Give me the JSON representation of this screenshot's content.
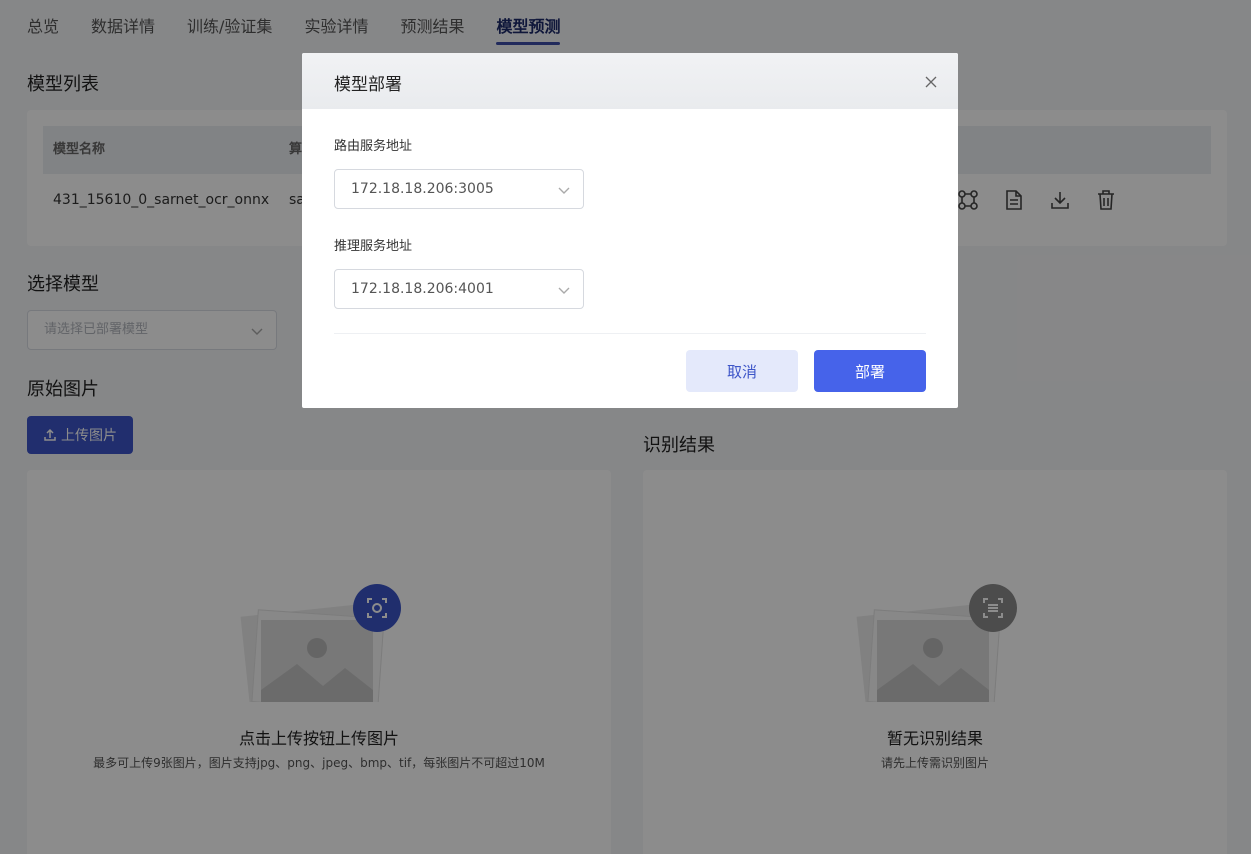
{
  "tabs": [
    {
      "label": "总览"
    },
    {
      "label": "数据详情"
    },
    {
      "label": "训练/验证集"
    },
    {
      "label": "实验详情"
    },
    {
      "label": "预测结果"
    },
    {
      "label": "模型预测",
      "active": true
    }
  ],
  "model_list": {
    "title": "模型列表",
    "columns": [
      "模型名称",
      "算"
    ],
    "rows": [
      {
        "name": "431_15610_0_sarnet_ocr_onnx",
        "algo": "sa"
      }
    ],
    "row_actions": [
      "deploy-graph-icon",
      "document-icon",
      "download-icon",
      "delete-icon"
    ]
  },
  "select_model": {
    "title": "选择模型",
    "placeholder": "请选择已部署模型"
  },
  "original_image": {
    "title": "原始图片",
    "upload_label": "上传图片",
    "empty_title": "点击上传按钮上传图片",
    "empty_sub": "最多可上传9张图片，图片支持jpg、png、jpeg、bmp、tif，每张图片不可超过10M"
  },
  "result": {
    "title": "识别结果",
    "empty_title": "暂无识别结果",
    "empty_sub": "请先上传需识别图片"
  },
  "modal": {
    "title": "模型部署",
    "route_label": "路由服务地址",
    "route_value": "172.18.18.206:3005",
    "infer_label": "推理服务地址",
    "infer_value": "172.18.18.206:4001",
    "cancel_label": "取消",
    "confirm_label": "部署"
  },
  "colors": {
    "primary": "#4663ea",
    "primary_dark": "#3d55c8",
    "overlay": "rgba(0,0,0,0.45)"
  }
}
